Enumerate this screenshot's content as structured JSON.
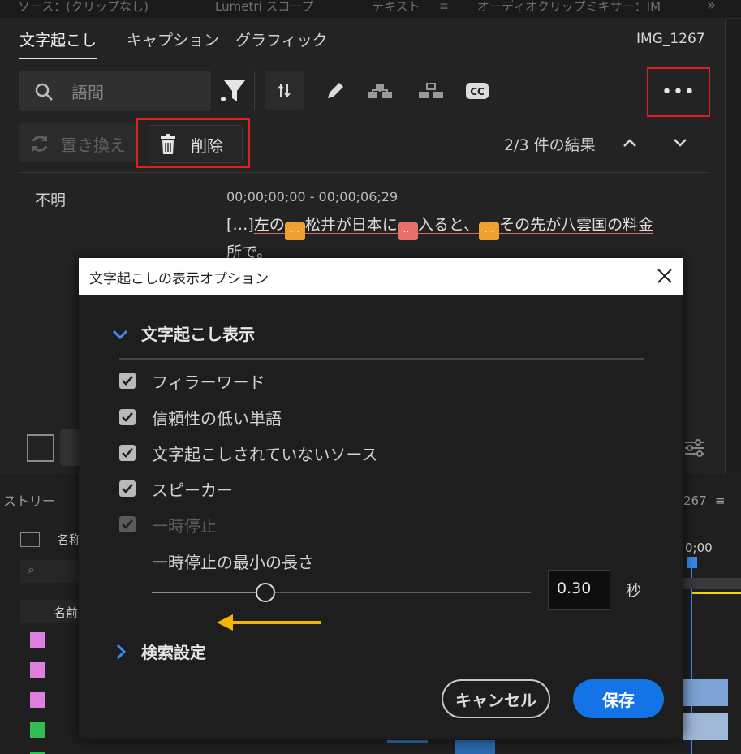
{
  "top_tabs": [
    {
      "label": "ソース：(クリップなし)"
    },
    {
      "label": "Lumetri スコープ"
    },
    {
      "label": "テキスト"
    },
    {
      "label": "オーディオクリップミキサー：IM"
    }
  ],
  "panel": {
    "tabs": [
      {
        "label": "文字起こし",
        "active": true
      },
      {
        "label": "キャプション"
      },
      {
        "label": "グラフィック"
      }
    ],
    "clip_name": "IMG_1267",
    "search": {
      "placeholder": "語間"
    },
    "replace_label": "置き換え",
    "delete_label": "削除",
    "results_text": "2/3 件の結果",
    "speaker": "不明",
    "timecode": "00;00;00;00 - 00;00;06;29",
    "transcript": {
      "open_bracket": "[…]",
      "seg1": "左の",
      "seg2": "松井が日本に",
      "seg3": "入ると、",
      "seg4": "その先が八雲国の料金",
      "line2": "所で。",
      "token_glyph": "…"
    }
  },
  "dialog": {
    "title": "文字起こしの表示オプション",
    "section_display": "文字起こし表示",
    "options": [
      {
        "label": "フィラーワード",
        "checked": true,
        "enabled": true
      },
      {
        "label": "信頼性の低い単語",
        "checked": true,
        "enabled": true
      },
      {
        "label": "文字起こしされていないソース",
        "checked": true,
        "enabled": true
      },
      {
        "label": "スピーカー",
        "checked": true,
        "enabled": true
      },
      {
        "label": "一時停止",
        "checked": true,
        "enabled": false
      }
    ],
    "pause_min_label": "一時停止の最小の長さ",
    "pause_value": "0.30",
    "pause_unit": "秒",
    "pause_slider_fraction": 0.3,
    "section_search": "検索設定",
    "cancel_label": "キャンセル",
    "save_label": "保存"
  },
  "background": {
    "history_label": "ストリー",
    "name_label": "名称",
    "name_col": "名前",
    "seq_label": "267",
    "time_label": "0;00"
  },
  "colors": {
    "accent_blue": "#1473e6",
    "annotation_red": "#e01f1f",
    "annotation_arrow": "#f5b400",
    "token_orange": "#f0a030",
    "token_red": "#e8706a",
    "swatch_pink": "#e07de0",
    "swatch_green": "#2fbf4f"
  },
  "icons": [
    "search-icon",
    "filter-icon",
    "split-icon",
    "pencil-icon",
    "merge-icon",
    "unmerge-icon",
    "cc-icon",
    "more-icon",
    "refresh-icon",
    "trash-icon",
    "chevron-up-icon",
    "chevron-down-icon",
    "close-icon"
  ]
}
